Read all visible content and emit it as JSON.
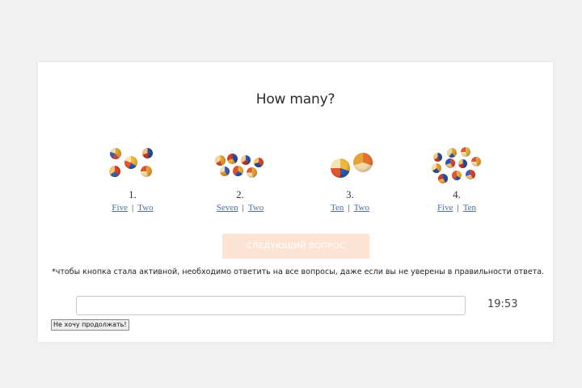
{
  "quiz": {
    "title": "How many?",
    "questions": [
      {
        "number": "1.",
        "options": [
          "Five",
          "Two"
        ]
      },
      {
        "number": "2.",
        "options": [
          "Seven",
          "Two"
        ]
      },
      {
        "number": "3.",
        "options": [
          "Ten",
          "Two"
        ]
      },
      {
        "number": "4.",
        "options": [
          "Five",
          "Ten"
        ]
      }
    ],
    "ball_counts": [
      5,
      7,
      2,
      10
    ],
    "next_button_label": "СЛЕДУЮЩИЙ ВОПРОС",
    "note": "*чтобы кнопка стала активной, необходимо ответить на все вопросы, даже если вы не уверены в правильности ответа.",
    "input_value": "",
    "timer": "19:53",
    "quit_button_label": "Не хочу продолжать!"
  },
  "colors": {
    "background": "#f1f1f1",
    "card": "#ffffff",
    "link": "#4a6fa5",
    "next_button_disabled": "#fde3d4"
  }
}
